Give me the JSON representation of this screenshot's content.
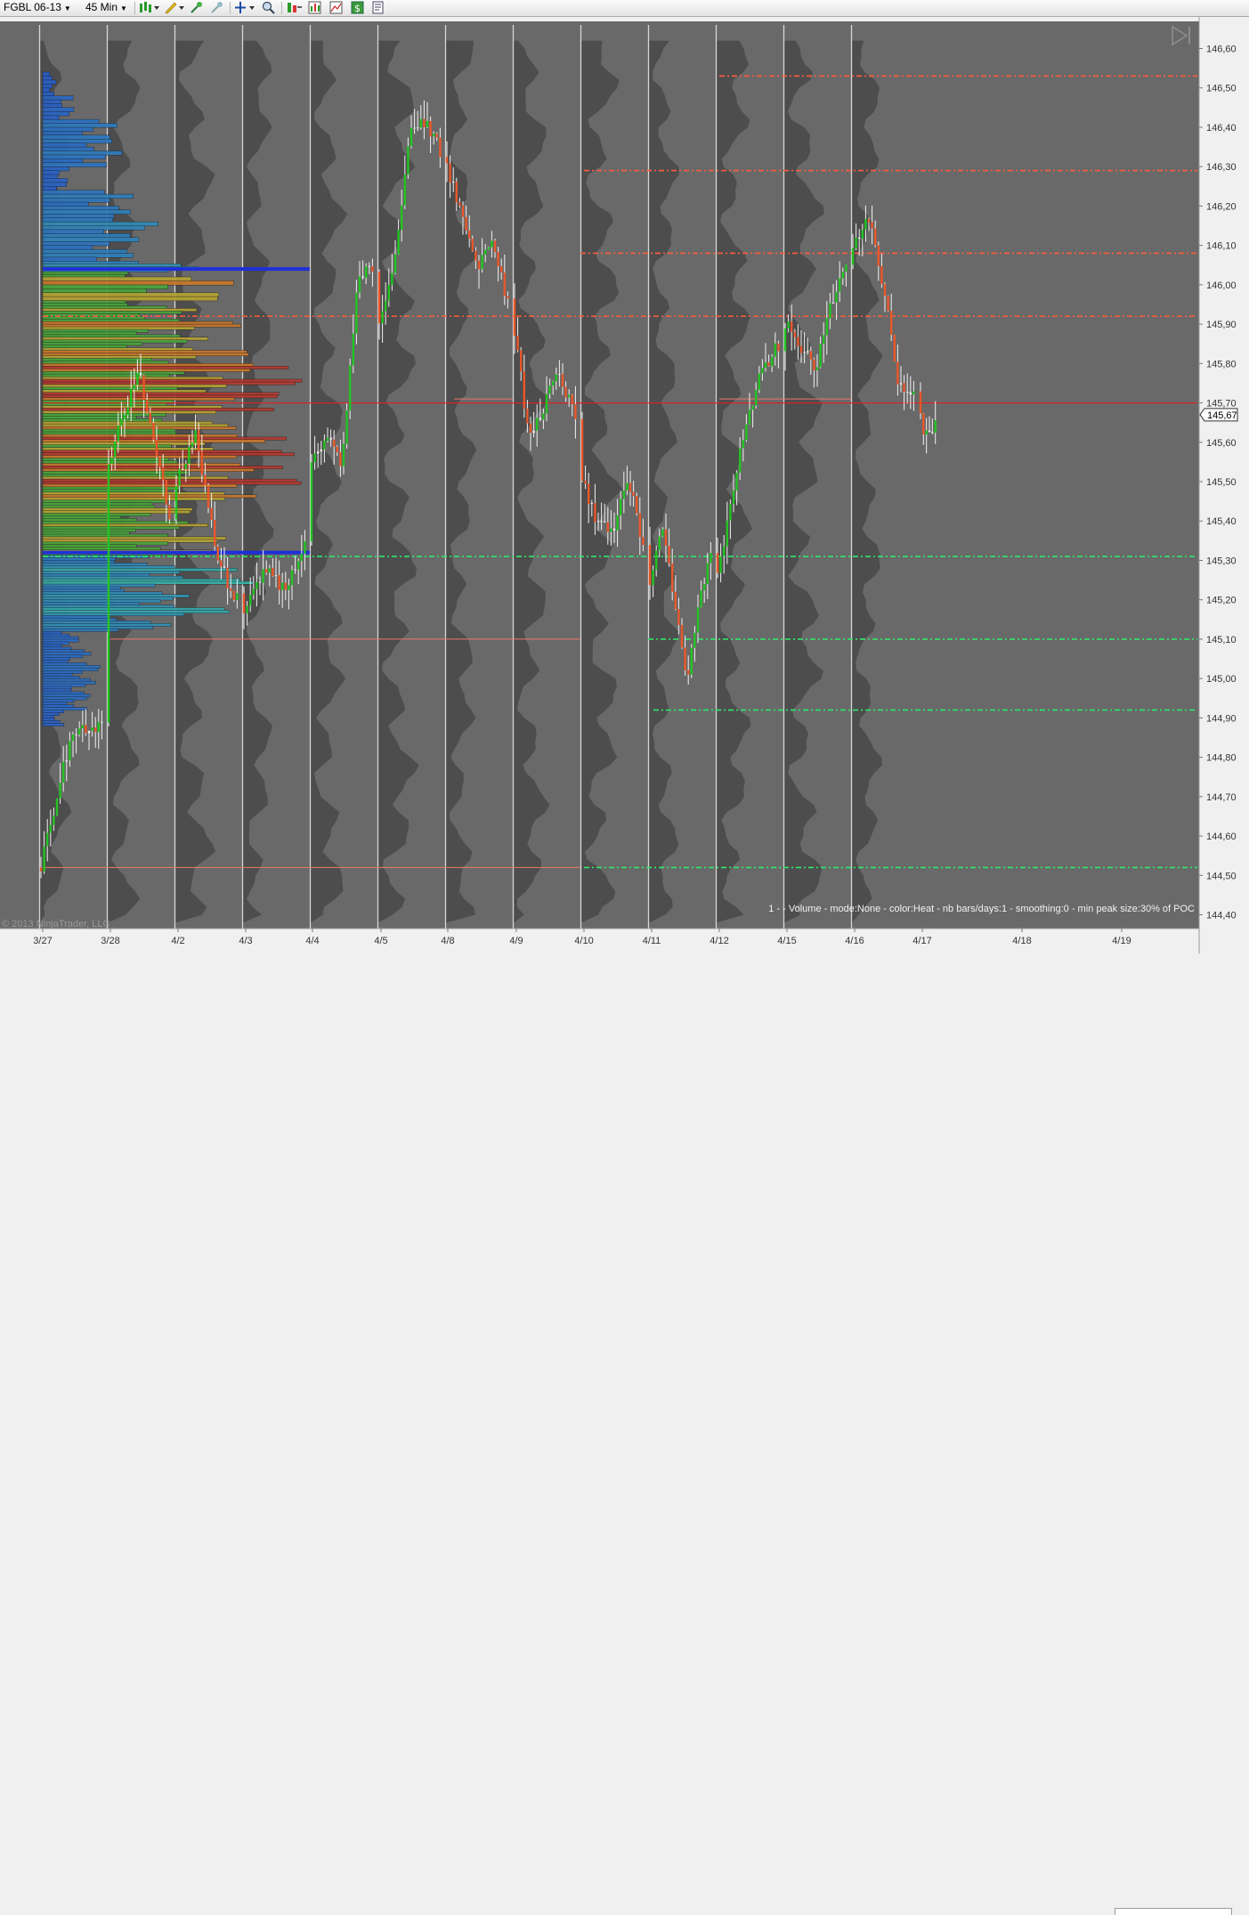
{
  "toolbar": {
    "instrument": "FGBL 06-13",
    "interval": "45 Min",
    "icons": [
      "bar-style-icon",
      "pencil-draw-icon",
      "zoom-in-icon",
      "zoom-out-icon",
      "crosshair-icon",
      "magnifier-icon",
      "strategy-icon",
      "indicators-icon",
      "chart-style-icon",
      "dollar-icon",
      "properties-icon"
    ]
  },
  "chart": {
    "price_axis_labels": [
      "146,60",
      "146,50",
      "146,40",
      "146,30",
      "146,20",
      "146,10",
      "146,00",
      "145,90",
      "145,80",
      "145,70",
      "145,60",
      "145,50",
      "145,40",
      "145,30",
      "145,20",
      "145,10",
      "145,00",
      "144,90",
      "144,80",
      "144,70",
      "144,60",
      "144,50",
      "144,40"
    ],
    "date_labels": [
      "3/27",
      "3/28",
      "4/2",
      "4/3",
      "4/4",
      "4/5",
      "4/8",
      "4/9",
      "4/10",
      "4/11",
      "4/12",
      "4/15",
      "4/16",
      "4/17",
      "4/18",
      "4/19"
    ],
    "current_price": "145,67",
    "indicator_text": "1 -   - Volume - mode:None - color:Heat - nb bars/days:1 - smoothing:0 - min peak size:30% of POC",
    "copyright": "© 2013 NinjaTrader, LLC",
    "colors": {
      "background": "#696969",
      "up_candle": "#22c322",
      "down_candle": "#e9572a",
      "doji": "#f0f0f0",
      "resistance_line": "#ff5a3c",
      "support_line": "#2ee86a",
      "poc_line": "#e02020",
      "value_area_line": "#1f2fd8"
    }
  },
  "chart_data": {
    "type": "candlestick",
    "symbol": "FGBL 06-13",
    "interval": "45 Min",
    "ylim": [
      144.38,
      146.62
    ],
    "y_ticks": [
      146.6,
      146.5,
      146.4,
      146.3,
      146.2,
      146.1,
      146.0,
      145.9,
      145.8,
      145.7,
      145.6,
      145.5,
      145.4,
      145.3,
      145.2,
      145.1,
      145.0,
      144.9,
      144.8,
      144.7,
      144.6,
      144.5,
      144.4
    ],
    "sessions": [
      "3/27",
      "3/28",
      "4/2",
      "4/3",
      "4/4",
      "4/5",
      "4/8",
      "4/9",
      "4/10",
      "4/11",
      "4/12",
      "4/15",
      "4/16",
      "4/17",
      "4/18",
      "4/19"
    ],
    "last_price": 145.67,
    "price_path": [
      [
        "3/27",
        144.52
      ],
      [
        "3/27",
        144.86
      ],
      [
        "3/27",
        144.88
      ],
      [
        "3/28",
        145.55
      ],
      [
        "3/28",
        145.78
      ],
      [
        "3/28",
        145.42
      ],
      [
        "4/2",
        145.5
      ],
      [
        "4/2",
        145.62
      ],
      [
        "4/2",
        145.3
      ],
      [
        "4/2",
        145.2
      ],
      [
        "4/3",
        145.18
      ],
      [
        "4/3",
        145.28
      ],
      [
        "4/3",
        145.22
      ],
      [
        "4/3",
        145.35
      ],
      [
        "4/4",
        145.55
      ],
      [
        "4/4",
        145.62
      ],
      [
        "4/4",
        145.55
      ],
      [
        "4/4",
        146.0
      ],
      [
        "4/4",
        146.05
      ],
      [
        "4/5",
        145.9
      ],
      [
        "4/5",
        146.05
      ],
      [
        "4/5",
        146.4
      ],
      [
        "4/5",
        146.42
      ],
      [
        "4/5",
        146.34
      ],
      [
        "4/8",
        146.3
      ],
      [
        "4/8",
        146.18
      ],
      [
        "4/8",
        146.05
      ],
      [
        "4/8",
        146.1
      ],
      [
        "4/8",
        145.95
      ],
      [
        "4/9",
        145.88
      ],
      [
        "4/9",
        145.6
      ],
      [
        "4/9",
        145.7
      ],
      [
        "4/9",
        145.78
      ],
      [
        "4/9",
        145.65
      ],
      [
        "4/10",
        145.5
      ],
      [
        "4/10",
        145.4
      ],
      [
        "4/10",
        145.38
      ],
      [
        "4/10",
        145.52
      ],
      [
        "4/10",
        145.32
      ],
      [
        "4/11",
        145.22
      ],
      [
        "4/11",
        145.4
      ],
      [
        "4/11",
        145.2
      ],
      [
        "4/11",
        144.98
      ],
      [
        "4/11",
        145.2
      ],
      [
        "4/11",
        145.3
      ],
      [
        "4/12",
        145.26
      ],
      [
        "4/12",
        145.55
      ],
      [
        "4/12",
        145.75
      ],
      [
        "4/12",
        145.85
      ],
      [
        "4/15",
        145.9
      ],
      [
        "4/15",
        145.85
      ],
      [
        "4/15",
        145.78
      ],
      [
        "4/15",
        145.95
      ],
      [
        "4/15",
        146.05
      ],
      [
        "4/16",
        146.08
      ],
      [
        "4/16",
        146.18
      ],
      [
        "4/16",
        146.0
      ],
      [
        "4/16",
        145.75
      ],
      [
        "4/16",
        145.72
      ],
      [
        "4/17",
        145.66
      ],
      [
        "4/17",
        145.6
      ],
      [
        "4/17",
        145.67
      ]
    ],
    "horizontal_levels": [
      {
        "kind": "resistance",
        "price": 146.53
      },
      {
        "kind": "resistance",
        "price": 146.29
      },
      {
        "kind": "resistance",
        "price": 146.08
      },
      {
        "kind": "resistance",
        "price": 145.92
      },
      {
        "kind": "poc",
        "price": 145.7
      },
      {
        "kind": "support",
        "price": 145.31
      },
      {
        "kind": "support",
        "price": 145.1
      },
      {
        "kind": "support",
        "price": 144.92
      },
      {
        "kind": "support",
        "price": 144.52
      },
      {
        "kind": "value_area",
        "price": 146.04
      },
      {
        "kind": "value_area",
        "price": 145.32
      }
    ],
    "volume_profile": {
      "mode": "None",
      "color": "Heat",
      "bars_per_day": 1,
      "smoothing": 0,
      "min_peak_size": "30% of POC",
      "poc": 145.53,
      "value_area_high": 146.04,
      "value_area_low": 145.32,
      "range": [
        144.86,
        146.54
      ],
      "profile_shape": [
        [
          146.54,
          0.05
        ],
        [
          146.48,
          0.12
        ],
        [
          146.42,
          0.28
        ],
        [
          146.36,
          0.3
        ],
        [
          146.3,
          0.1
        ],
        [
          146.24,
          0.34
        ],
        [
          146.18,
          0.45
        ],
        [
          146.12,
          0.36
        ],
        [
          146.06,
          0.58
        ],
        [
          146.02,
          0.72
        ],
        [
          145.96,
          0.58
        ],
        [
          145.92,
          0.76
        ],
        [
          145.88,
          0.62
        ],
        [
          145.84,
          0.8
        ],
        [
          145.8,
          0.92
        ],
        [
          145.76,
          1.0
        ],
        [
          145.72,
          0.88
        ],
        [
          145.68,
          0.7
        ],
        [
          145.64,
          0.92
        ],
        [
          145.6,
          0.96
        ],
        [
          145.56,
          0.9
        ],
        [
          145.52,
          1.0
        ],
        [
          145.48,
          0.8
        ],
        [
          145.44,
          0.58
        ],
        [
          145.4,
          0.62
        ],
        [
          145.36,
          0.7
        ],
        [
          145.32,
          0.5
        ],
        [
          145.28,
          0.8
        ],
        [
          145.24,
          0.55
        ],
        [
          145.2,
          0.72
        ],
        [
          145.16,
          0.48
        ],
        [
          145.12,
          0.14
        ],
        [
          145.08,
          0.18
        ],
        [
          145.04,
          0.22
        ],
        [
          145.0,
          0.2
        ],
        [
          144.96,
          0.18
        ],
        [
          144.92,
          0.08
        ],
        [
          144.88,
          0.03
        ]
      ]
    }
  }
}
